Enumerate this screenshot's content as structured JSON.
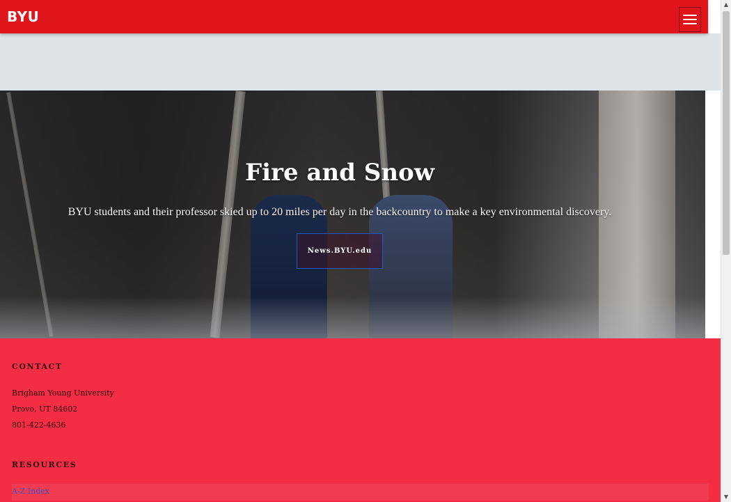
{
  "header": {
    "logo_text": "BYU",
    "menu_icon": "hamburger-menu-icon",
    "brand_color": "#e0151b"
  },
  "hero": {
    "title": "Fire and Snow",
    "subtitle": "BYU students and their professor skied up to 20 miles per day in the backcountry to make a key environmental discovery.",
    "button_label": "News.BYU.edu"
  },
  "footer": {
    "background_color": "#f22d44",
    "contact": {
      "heading": "CONTACT",
      "lines": [
        "Brigham Young University",
        "Provo, UT 84602",
        "801-422-4636"
      ]
    },
    "resources": {
      "heading": "RESOURCES",
      "links": [
        "A-Z Index"
      ]
    }
  },
  "scrollbar": {
    "up_icon": "scroll-up-arrow-icon",
    "down_icon": "scroll-down-arrow-icon"
  }
}
